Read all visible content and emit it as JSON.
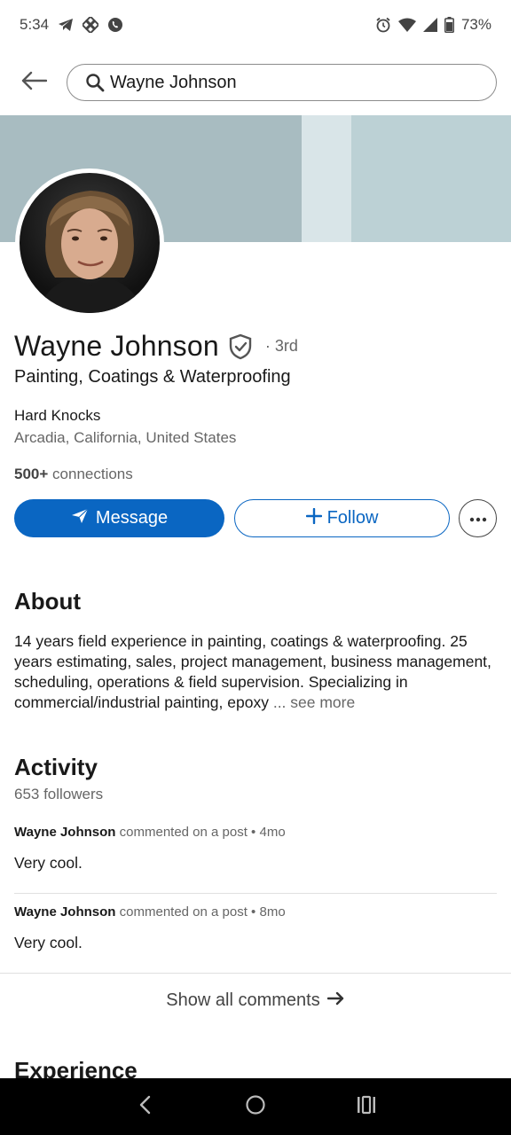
{
  "status_bar": {
    "time": "5:34",
    "battery": "73%",
    "left_icons": [
      "telegram-icon",
      "binance-icon",
      "viber-icon"
    ],
    "right_icons": [
      "alarm-icon",
      "wifi-icon",
      "signal-icon",
      "battery-icon"
    ]
  },
  "search": {
    "query": "Wayne Johnson"
  },
  "profile": {
    "name": "Wayne Johnson",
    "degree": "· 3rd",
    "headline": "Painting, Coatings & Waterproofing",
    "company": "Hard Knocks",
    "location": "Arcadia, California, United States",
    "connections_count": "500+",
    "connections_label": "connections"
  },
  "actions": {
    "message_label": "Message",
    "follow_label": "Follow"
  },
  "about": {
    "title": "About",
    "text": "14 years field experience in painting, coatings & waterproofing. 25 years estimating, sales, project management, business management, scheduling, operations & field supervision. Specializing in commercial/industrial painting, epoxy",
    "see_more": "... see more"
  },
  "activity": {
    "title": "Activity",
    "followers": "653 followers",
    "items": [
      {
        "author": "Wayne Johnson",
        "action": "commented on a post • 4mo",
        "text": "Very cool."
      },
      {
        "author": "Wayne Johnson",
        "action": "commented on a post • 8mo",
        "text": "Very cool."
      }
    ],
    "show_all": "Show all comments"
  },
  "experience": {
    "title": "Experience"
  },
  "colors": {
    "primary": "#0a66c2",
    "banner": "#a9bfc3"
  }
}
